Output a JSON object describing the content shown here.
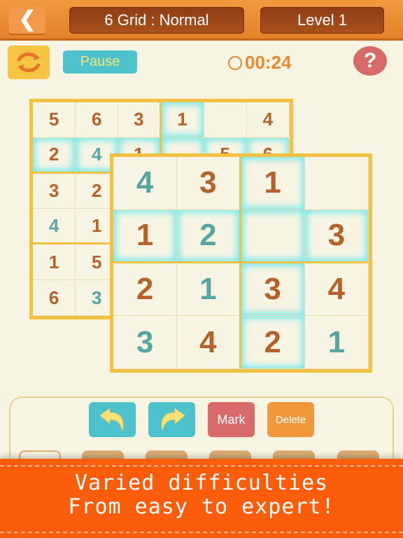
{
  "header": {
    "back_icon": "chevron-left-icon",
    "mode": "6 Grid : Normal",
    "level": "Level 1"
  },
  "toolbar": {
    "refresh_icon": "refresh-icon",
    "pause": "Pause",
    "clock_icon": "clock-icon",
    "timer": "00:24",
    "help": "?"
  },
  "back_board": {
    "size": 6,
    "rows": [
      [
        "5",
        "6",
        "3",
        "1",
        "",
        "4"
      ],
      [
        "2",
        "4",
        "1",
        "",
        "5",
        "6"
      ],
      [
        "3",
        "2",
        "",
        "",
        "",
        ""
      ],
      [
        "4",
        "1",
        "",
        "",
        "",
        ""
      ],
      [
        "1",
        "5",
        "",
        "",
        "",
        ""
      ],
      [
        "6",
        "3",
        "",
        "",
        "",
        ""
      ]
    ],
    "teal": [
      [
        1,
        1
      ],
      [
        3,
        0
      ],
      [
        5,
        1
      ]
    ],
    "highlight_row": 1,
    "highlight_col": 3
  },
  "front_board": {
    "size": 4,
    "rows": [
      [
        "4",
        "3",
        "1",
        ""
      ],
      [
        "1",
        "2",
        "",
        "3"
      ],
      [
        "2",
        "1",
        "3",
        "4"
      ],
      [
        "3",
        "4",
        "2",
        "1"
      ]
    ],
    "teal": [
      [
        0,
        0
      ],
      [
        1,
        1
      ],
      [
        2,
        1
      ],
      [
        3,
        0
      ],
      [
        3,
        3
      ]
    ],
    "highlight_row": 1,
    "highlight_col": 2
  },
  "actions": {
    "undo_icon": "undo-arrow-icon",
    "redo_icon": "redo-arrow-icon",
    "mark": "Mark",
    "delete": "Delete"
  },
  "banner": {
    "line1": "Varied difficulties",
    "line2": "From easy to expert!"
  },
  "colors": {
    "accent": "#e4822a",
    "teal": "#4ec2cc",
    "brown_digit": "#b5612a",
    "teal_digit": "#56a6a2",
    "banner": "#fb5d0a",
    "grid_border": "#f2c141"
  }
}
